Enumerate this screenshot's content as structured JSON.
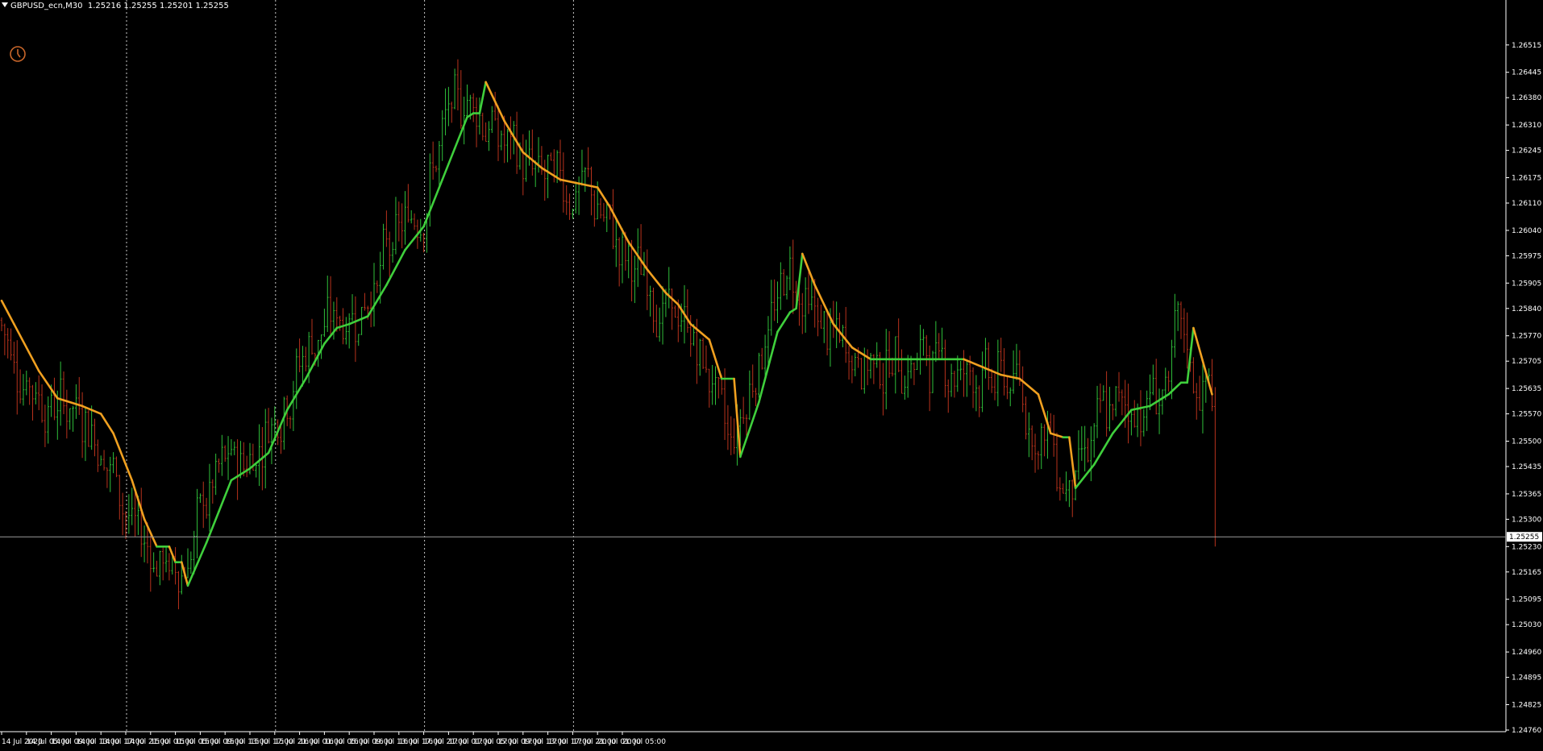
{
  "header": {
    "symbol": "GBPUSD_ecn,M30",
    "quotes": "1.25216 1.25255 1.25201 1.25255"
  },
  "colors": {
    "background": "#000000",
    "bull": "#2fbf3a",
    "bear": "#b8321c",
    "ma_up": "#3fcf3c",
    "ma_down": "#f0a020",
    "grid": "#c8c8c8",
    "axis": "#ffffff"
  },
  "icons": {
    "clock": "clock-icon"
  },
  "chart_data": {
    "type": "candlestick",
    "current_price": "1.25255",
    "y_ticks": [
      "1.26515",
      "1.26445",
      "1.26380",
      "1.26310",
      "1.26245",
      "1.26175",
      "1.26110",
      "1.26040",
      "1.25975",
      "1.25905",
      "1.25840",
      "1.25770",
      "1.25705",
      "1.25635",
      "1.25570",
      "1.25500",
      "1.25435",
      "1.25365",
      "1.25300",
      "1.25230",
      "1.25165",
      "1.25095",
      "1.25030",
      "1.24960",
      "1.24895",
      "1.24825",
      "1.24760"
    ],
    "ylim": [
      1.2476,
      1.2656
    ],
    "x_ticks": [
      "14 Jul 2020",
      "14 Jul 05:00",
      "14 Jul 09:00",
      "14 Jul 13:00",
      "14 Jul 17:00",
      "14 Jul 21:00",
      "15 Jul 01:00",
      "15 Jul 05:00",
      "15 Jul 09:00",
      "15 Jul 13:00",
      "15 Jul 17:00",
      "15 Jul 21:00",
      "16 Jul 01:00",
      "16 Jul 05:00",
      "16 Jul 09:00",
      "16 Jul 13:00",
      "16 Jul 17:00",
      "16 Jul 21:00",
      "17 Jul 01:00",
      "17 Jul 05:00",
      "17 Jul 09:00",
      "17 Jul 13:00",
      "17 Jul 17:00",
      "17 Jul 21:00",
      "20 Jul 01:00",
      "20 Jul 05:00"
    ],
    "ma": [
      [
        0,
        1.2586
      ],
      [
        4,
        1.258
      ],
      [
        12,
        1.2568
      ],
      [
        18,
        1.2561
      ],
      [
        26,
        1.2559
      ],
      [
        32,
        1.2557
      ],
      [
        36,
        1.2552
      ],
      [
        42,
        1.254
      ],
      [
        46,
        1.253
      ],
      [
        50,
        1.2523
      ],
      [
        54,
        1.2523
      ],
      [
        56,
        1.2519
      ],
      [
        58,
        1.2519
      ],
      [
        60,
        1.2513
      ],
      [
        66,
        1.2524
      ],
      [
        70,
        1.2532
      ],
      [
        74,
        1.254
      ],
      [
        80,
        1.2543
      ],
      [
        86,
        1.2547
      ],
      [
        92,
        1.2558
      ],
      [
        98,
        1.2566
      ],
      [
        104,
        1.2575
      ],
      [
        108,
        1.2579
      ],
      [
        112,
        1.258
      ],
      [
        118,
        1.2582
      ],
      [
        124,
        1.259
      ],
      [
        130,
        1.2599
      ],
      [
        136,
        1.2605
      ],
      [
        142,
        1.2617
      ],
      [
        146,
        1.2625
      ],
      [
        150,
        1.2633
      ],
      [
        152,
        1.2634
      ],
      [
        154,
        1.2634
      ],
      [
        156,
        1.2642
      ],
      [
        162,
        1.2632
      ],
      [
        168,
        1.2624
      ],
      [
        174,
        1.262
      ],
      [
        180,
        1.2617
      ],
      [
        186,
        1.2616
      ],
      [
        192,
        1.2615
      ],
      [
        196,
        1.261
      ],
      [
        202,
        1.2601
      ],
      [
        208,
        1.2594
      ],
      [
        214,
        1.2588
      ],
      [
        218,
        1.2585
      ],
      [
        222,
        1.258
      ],
      [
        228,
        1.2576
      ],
      [
        232,
        1.2566
      ],
      [
        236,
        1.2566
      ],
      [
        238,
        1.2546
      ],
      [
        244,
        1.256
      ],
      [
        250,
        1.2578
      ],
      [
        254,
        1.2583
      ],
      [
        256,
        1.2584
      ],
      [
        258,
        1.2598
      ],
      [
        262,
        1.259
      ],
      [
        268,
        1.258
      ],
      [
        274,
        1.2574
      ],
      [
        280,
        1.2571
      ],
      [
        290,
        1.2571
      ],
      [
        300,
        1.2571
      ],
      [
        310,
        1.2571
      ],
      [
        316,
        1.2569
      ],
      [
        322,
        1.2567
      ],
      [
        328,
        1.2566
      ],
      [
        334,
        1.2562
      ],
      [
        338,
        1.2552
      ],
      [
        342,
        1.2551
      ],
      [
        344,
        1.2551
      ],
      [
        346,
        1.2538
      ],
      [
        352,
        1.2544
      ],
      [
        358,
        1.2552
      ],
      [
        364,
        1.2558
      ],
      [
        370,
        1.2559
      ],
      [
        376,
        1.2562
      ],
      [
        380,
        1.2565
      ],
      [
        382,
        1.2565
      ],
      [
        384,
        1.2579
      ],
      [
        390,
        1.2562
      ]
    ]
  }
}
